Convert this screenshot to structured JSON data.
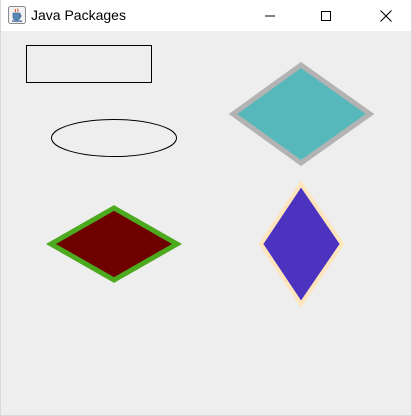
{
  "window": {
    "title": "Java Packages",
    "app_icon": "java-coffee-cup-icon",
    "controls": {
      "minimize_icon": "minimize-icon",
      "maximize_icon": "maximize-icon",
      "close_icon": "close-icon"
    }
  },
  "canvas": {
    "background": "#eeeeee",
    "shapes": [
      {
        "kind": "rectangle",
        "fill": "none",
        "stroke": "#000000"
      },
      {
        "kind": "ellipse",
        "fill": "none",
        "stroke": "#000000"
      },
      {
        "kind": "diamond",
        "fill": "#57b8bb",
        "stroke": "#b3b3b3"
      },
      {
        "kind": "diamond",
        "fill": "#6e0000",
        "stroke": "#4caa1e"
      },
      {
        "kind": "diamond",
        "fill": "#4c33bf",
        "stroke": "#fde6bd"
      }
    ]
  }
}
